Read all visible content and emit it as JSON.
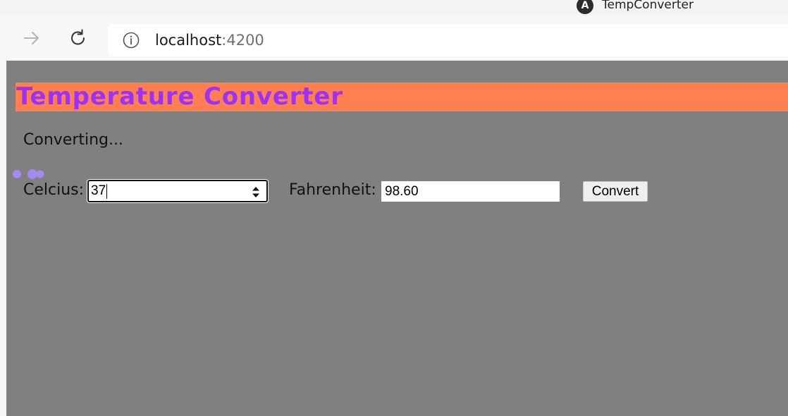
{
  "browser": {
    "tab": {
      "favicon_letter": "A",
      "favicon_icon": "angular-icon",
      "title": "TempConverter"
    },
    "toolbar": {
      "forward_icon": "arrow-right-icon",
      "reload_icon": "reload-icon",
      "site_info_icon": "info-icon"
    },
    "address": {
      "host": "localhost",
      "port": ":4200"
    }
  },
  "page": {
    "background_color": "#808080",
    "banner": {
      "title": "Temperature Converter",
      "background_color": "#ff7f50",
      "text_color": "#9b30ff"
    },
    "status": "Converting...",
    "form": {
      "celsius_label": "Celcius:",
      "celsius_value": "37",
      "fahrenheit_label": "Fahrenheit:",
      "fahrenheit_value": "98.60",
      "convert_label": "Convert"
    }
  }
}
